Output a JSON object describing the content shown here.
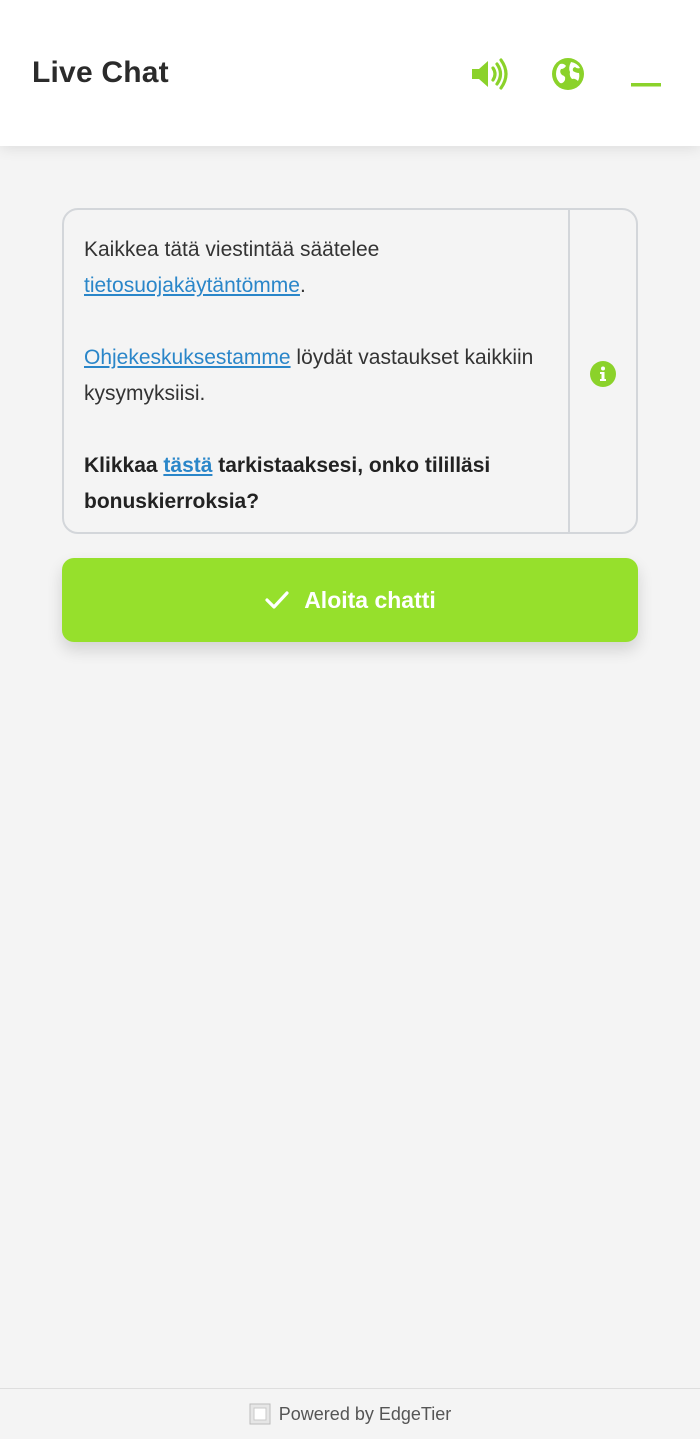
{
  "header": {
    "title": "Live Chat",
    "icons": [
      "sound-icon",
      "globe-icon",
      "minimize-icon"
    ]
  },
  "info": {
    "line1_text": "Kaikkea tätä viestintää säätelee ",
    "privacy_link": "tietosuojakäytäntömme",
    "line1_end": ".",
    "help_link": "Ohjekeskuksestamme",
    "help_text": " löydät vastaukset kaikkiin kysymyksiisi.",
    "bonus_prefix": "Klikkaa ",
    "bonus_link": "tästä",
    "bonus_text": "  tarkistaaksesi, onko tililläsi bonuskierroksia?"
  },
  "start_button": {
    "label": "Aloita chatti"
  },
  "footer": {
    "powered_by": "Powered by EdgeTier"
  },
  "colors": {
    "accent": "#96e02c",
    "link": "#2a86c9",
    "background": "#f4f4f4",
    "text": "#2b2b2b"
  }
}
